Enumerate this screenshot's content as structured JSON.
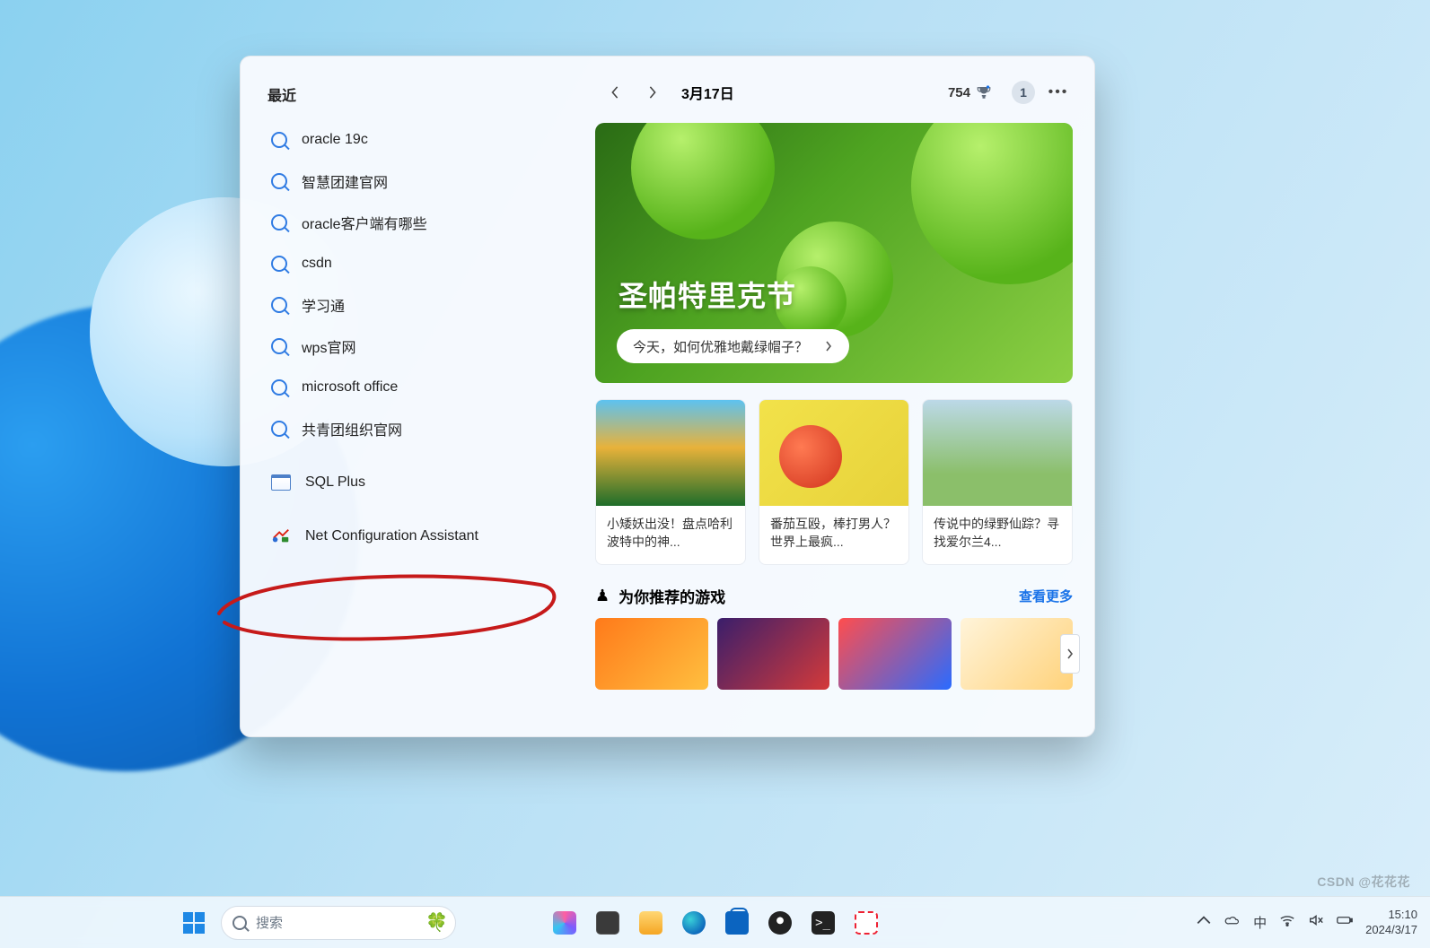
{
  "recent": {
    "title": "最近",
    "items": [
      {
        "type": "search",
        "label": "oracle 19c"
      },
      {
        "type": "search",
        "label": "智慧团建官网"
      },
      {
        "type": "search",
        "label": "oracle客户端有哪些"
      },
      {
        "type": "search",
        "label": "csdn"
      },
      {
        "type": "search",
        "label": "学习通"
      },
      {
        "type": "search",
        "label": "wps官网"
      },
      {
        "type": "search",
        "label": "microsoft office"
      },
      {
        "type": "search",
        "label": "共青团组织官网"
      },
      {
        "type": "app",
        "label": "SQL Plus",
        "icon": "sqlplus-icon"
      },
      {
        "type": "app",
        "label": "Net Configuration Assistant",
        "icon": "netca-icon"
      }
    ]
  },
  "feed": {
    "date": "3月17日",
    "points": "754",
    "badge": "1",
    "hero": {
      "title": "圣帕特里克节",
      "subtitle": "今天，如何优雅地戴绿帽子？"
    },
    "cards": [
      {
        "text": "小矮妖出没！盘点哈利波特中的神..."
      },
      {
        "text": "番茄互殴，棒打男人？世界上最疯..."
      },
      {
        "text": "传说中的绿野仙踪？寻找爱尔兰4..."
      }
    ],
    "games": {
      "title": "为你推荐的游戏",
      "see_more": "查看更多"
    }
  },
  "taskbar": {
    "search_placeholder": "搜索",
    "ime": "中",
    "time": "15:10",
    "date": "2024/3/17"
  },
  "watermark": "CSDN @花花花"
}
